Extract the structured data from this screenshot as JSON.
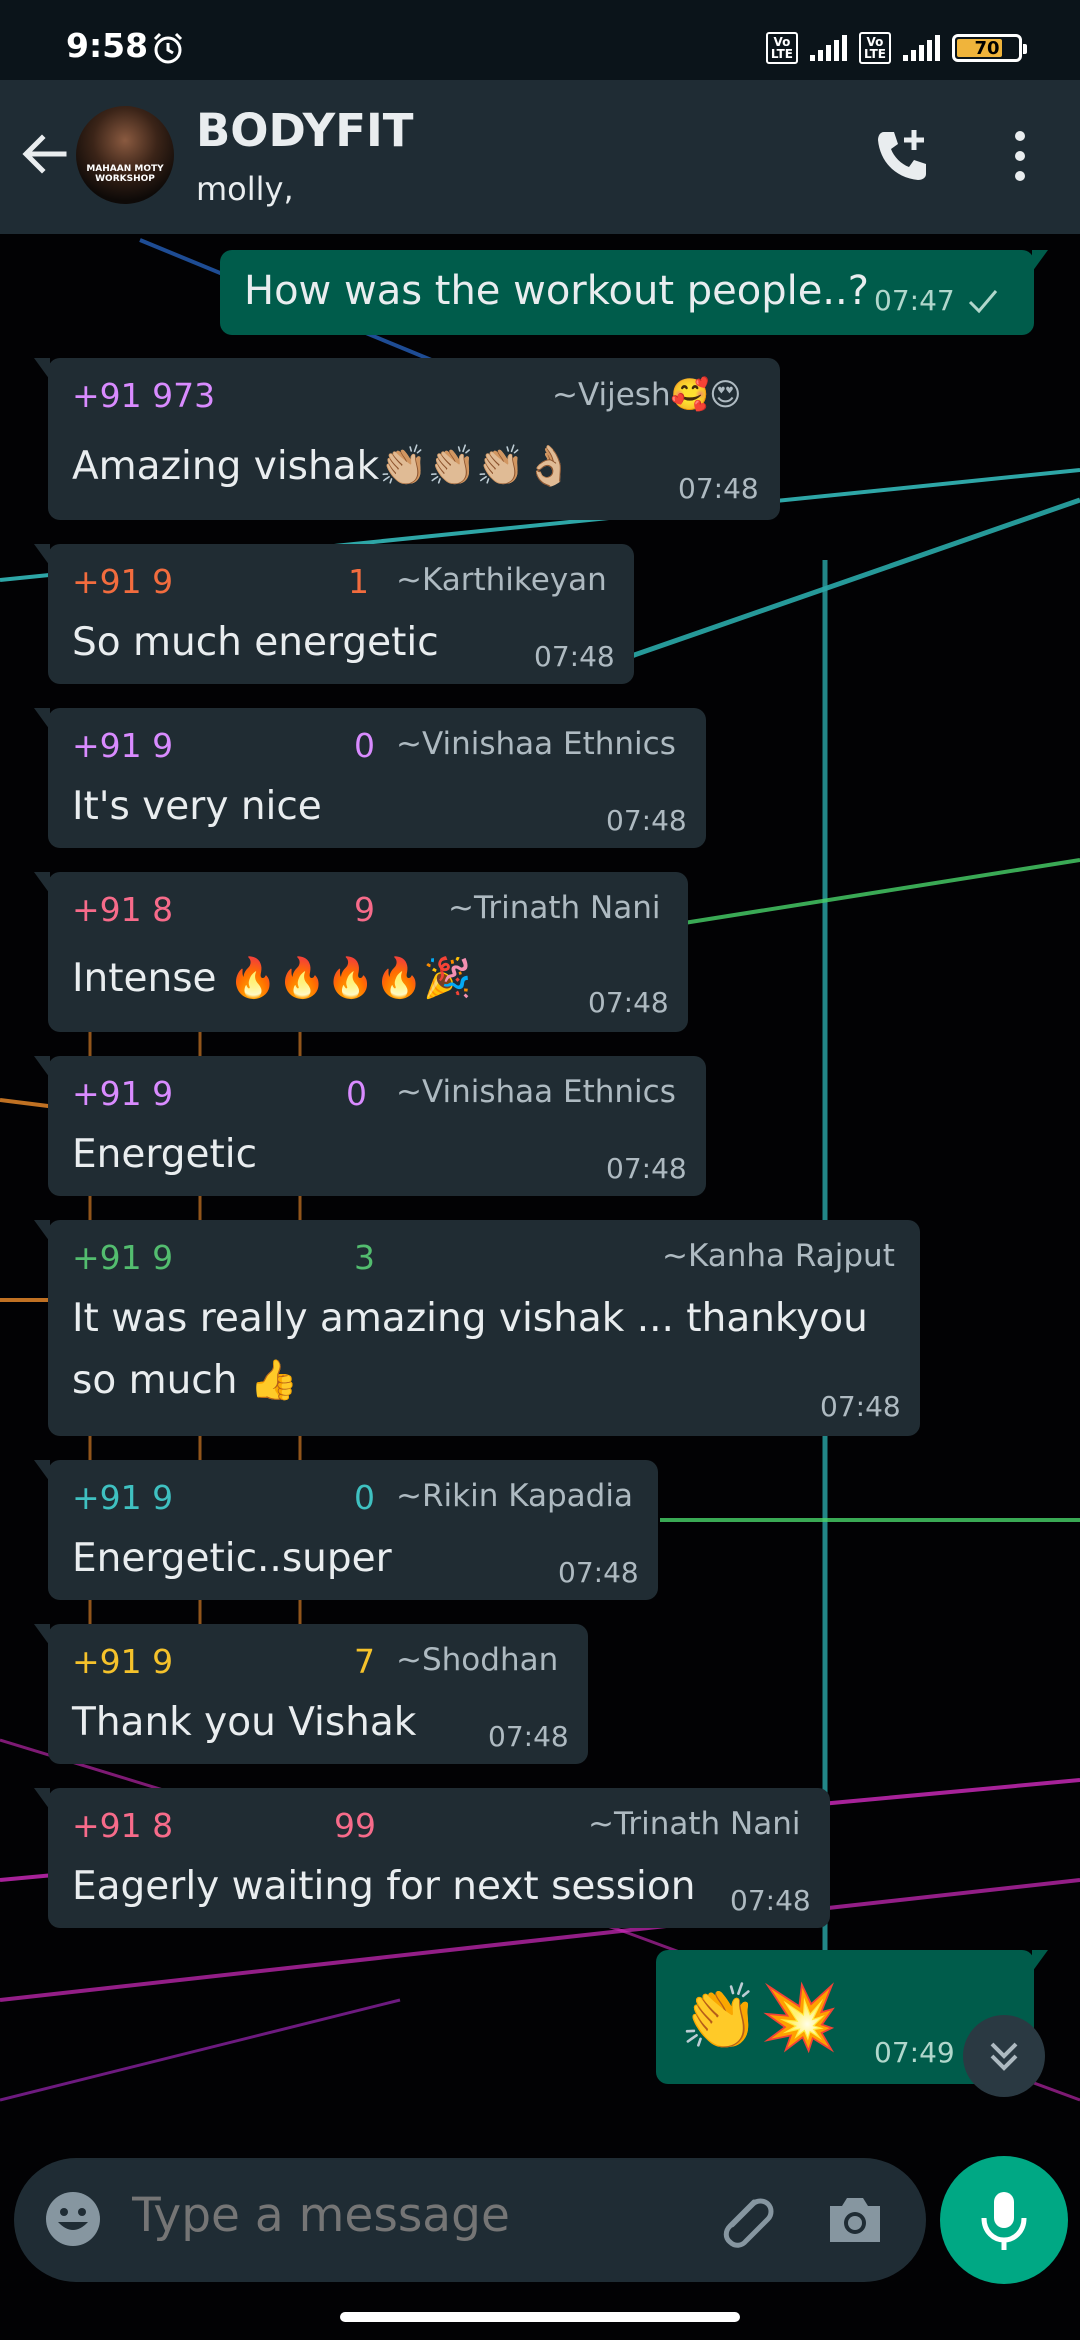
{
  "status_bar": {
    "time": "9:58",
    "battery": "70"
  },
  "header": {
    "title": "BODYFIT",
    "subtitle": "molly,",
    "avatar_text": "MAHAAN MOTY WORKSHOP"
  },
  "messages": [
    {
      "dir": "out",
      "text": "How was the workout people..?",
      "time": "07:47"
    },
    {
      "dir": "in",
      "sender": "+91 973",
      "alias": "~Vijesh🥰😍",
      "text": "Amazing vishak👏🏼👏🏼👏🏼👌🏼",
      "time": "07:48",
      "color": "#d98bff"
    },
    {
      "dir": "in",
      "sender": "+91 9",
      "sender_end": "1",
      "alias": "~Karthikeyan",
      "text": "So much energetic",
      "time": "07:48",
      "color": "#f26c3e"
    },
    {
      "dir": "in",
      "sender": "+91 9",
      "sender_end": "0",
      "alias": "~Vinishaa Ethnics",
      "text": "It's very nice",
      "time": "07:48",
      "color": "#d98bff"
    },
    {
      "dir": "in",
      "sender": "+91 8",
      "sender_end": "9",
      "alias": "~Trinath Nani",
      "text": "Intense 🔥🔥🔥🔥🎉",
      "time": "07:48",
      "color": "#f76b8a"
    },
    {
      "dir": "in",
      "sender": "+91 9",
      "sender_end": "0",
      "alias": "~Vinishaa Ethnics",
      "text": "Energetic",
      "time": "07:48",
      "color": "#d98bff"
    },
    {
      "dir": "in",
      "sender": "+91 9",
      "sender_end": "3",
      "alias": "~Kanha Rajput",
      "text_line1": "It was really amazing vishak ... thankyou",
      "text_line2": "so much 👍",
      "time": "07:48",
      "color": "#53bd6f"
    },
    {
      "dir": "in",
      "sender": "+91 9",
      "sender_end": "0",
      "alias": "~Rikin Kapadia",
      "text": "Energetic..super",
      "time": "07:48",
      "color": "#3fc1c1"
    },
    {
      "dir": "in",
      "sender": "+91 9",
      "sender_end": "7",
      "alias": "~Shodhan",
      "text": "Thank you Vishak",
      "time": "07:48",
      "color": "#f5c22b"
    },
    {
      "dir": "in",
      "sender": "+91 8",
      "sender_end": "99",
      "alias": "~Trinath Nani",
      "text": "Eagerly waiting for next session",
      "time": "07:48",
      "color": "#f76b8a"
    },
    {
      "dir": "out",
      "text": "👏💥",
      "time": "07:49"
    }
  ],
  "input": {
    "placeholder": "Type a message"
  },
  "icons": {
    "back": "arrow-left-icon",
    "call": "add-call-icon",
    "more": "more-vert-icon",
    "emoji": "emoji-icon",
    "attach": "paperclip-icon",
    "camera": "camera-icon",
    "mic": "mic-icon",
    "scroll": "chevron-double-down-icon"
  },
  "colors": {
    "header": "#1f2c34",
    "incoming": "#202c33",
    "outgoing": "#005c4b",
    "accent": "#00a884"
  }
}
